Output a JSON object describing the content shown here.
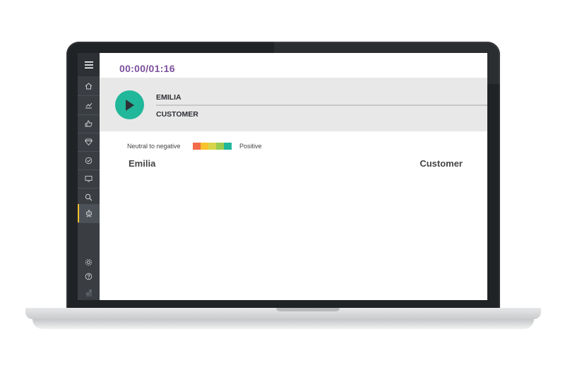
{
  "player": {
    "time": "00:00/01:16",
    "speakers": [
      "EMILIA",
      "CUSTOMER"
    ]
  },
  "legend": {
    "negative_label": "Neutral to negative",
    "positive_label": "Positive",
    "colors": [
      "#f26b4a",
      "#f7c22b",
      "#d8d54a",
      "#9acb4e",
      "#21b79a"
    ]
  },
  "transcript": {
    "left_name": "Emilia",
    "right_name": "Customer"
  },
  "sidebar": {
    "items": [
      "menu-icon",
      "home-icon",
      "chart-icon",
      "thumbs-up-icon",
      "diamond-icon",
      "check-circle-icon",
      "screen-icon",
      "search-icon",
      "robot-icon",
      "gear-icon",
      "help-icon",
      "logo-icon"
    ],
    "active": "robot-icon",
    "active_color": "#f2c12e"
  },
  "colors": {
    "accent": "#7b4f9d",
    "play": "#21b79a"
  }
}
